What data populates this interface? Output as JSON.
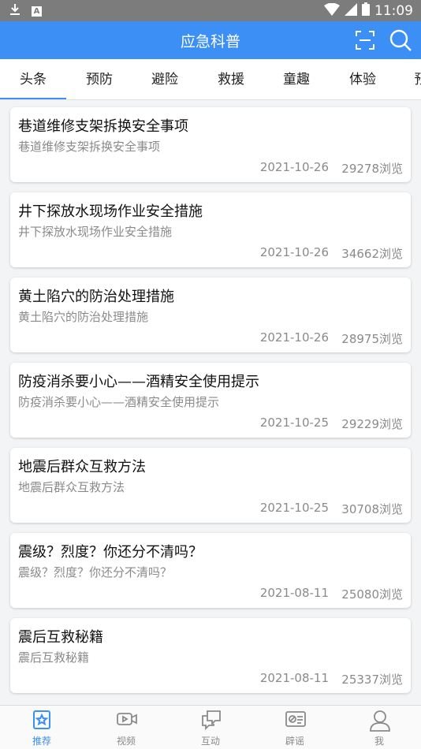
{
  "status_bar": {
    "time": "11:09"
  },
  "header": {
    "title": "应急科普"
  },
  "tabs": [
    {
      "label": "头条",
      "active": true
    },
    {
      "label": "预防",
      "active": false
    },
    {
      "label": "避险",
      "active": false
    },
    {
      "label": "救援",
      "active": false
    },
    {
      "label": "童趣",
      "active": false
    },
    {
      "label": "体验",
      "active": false
    },
    {
      "label": "预",
      "active": false
    }
  ],
  "articles": [
    {
      "title": "巷道维修支架拆换安全事项",
      "subtitle": "巷道维修支架拆换安全事项",
      "date": "2021-10-26",
      "views": "29278浏览"
    },
    {
      "title": "井下探放水现场作业安全措施",
      "subtitle": "井下探放水现场作业安全措施",
      "date": "2021-10-26",
      "views": "34662浏览"
    },
    {
      "title": "黄土陷穴的防治处理措施",
      "subtitle": "黄土陷穴的防治处理措施",
      "date": "2021-10-26",
      "views": "28975浏览"
    },
    {
      "title": "防疫消杀要小心——酒精安全使用提示",
      "subtitle": "防疫消杀要小心——酒精安全使用提示",
      "date": "2021-10-25",
      "views": "29229浏览"
    },
    {
      "title": "地震后群众互救方法",
      "subtitle": "地震后群众互救方法",
      "date": "2021-10-25",
      "views": "30708浏览"
    },
    {
      "title": "震级？烈度？你还分不清吗？",
      "subtitle": "震级？烈度？你还分不清吗？",
      "date": "2021-08-11",
      "views": "25080浏览"
    },
    {
      "title": "震后互救秘籍",
      "subtitle": "震后互救秘籍",
      "date": "2021-08-11",
      "views": "25337浏览"
    }
  ],
  "bottom_nav": [
    {
      "label": "推荐",
      "icon": "star-icon",
      "active": true
    },
    {
      "label": "视频",
      "icon": "video-icon",
      "active": false
    },
    {
      "label": "互动",
      "icon": "chat-icon",
      "active": false
    },
    {
      "label": "辟谣",
      "icon": "rumor-icon",
      "active": false
    },
    {
      "label": "我",
      "icon": "user-icon",
      "active": false
    }
  ],
  "colors": {
    "accent": "#3b8ff5",
    "status_bar": "#7c7c7c",
    "muted_text": "#8a8a8a"
  }
}
